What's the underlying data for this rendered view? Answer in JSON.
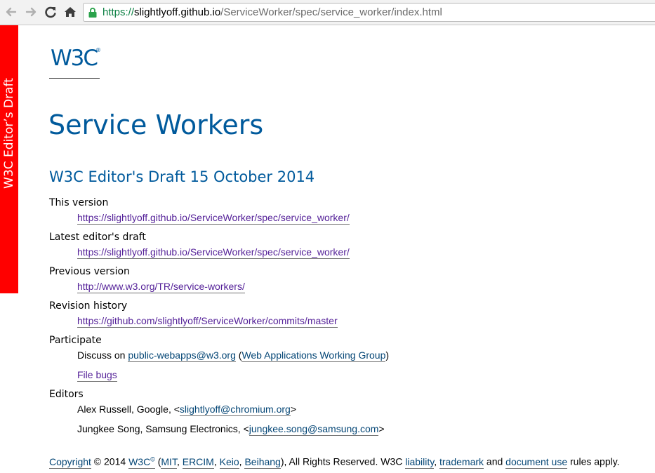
{
  "browser": {
    "back_icon": "back-arrow-icon",
    "forward_icon": "forward-arrow-icon",
    "reload_icon": "reload-icon",
    "home_icon": "home-icon",
    "url": {
      "scheme": "https://",
      "host": "slightlyoff.github.io",
      "path": "/ServiceWorker/spec/service_worker/index.html"
    },
    "secure_color": "#0b8043"
  },
  "badge": {
    "text": "W3C Editor’s Draft",
    "color": "#ff0000"
  },
  "logo": {
    "text": "W3C",
    "reg": "®",
    "color": "#005a9c"
  },
  "doc": {
    "title": "Service Workers",
    "subtitle": "W3C Editor's Draft 15 October 2014",
    "this_version": {
      "label": "This version",
      "link": "https://slightlyoff.github.io/ServiceWorker/spec/service_worker/"
    },
    "latest_draft": {
      "label": "Latest editor's draft",
      "link": "https://slightlyoff.github.io/ServiceWorker/spec/service_worker/"
    },
    "previous_version": {
      "label": "Previous version",
      "link": "http://www.w3.org/TR/service-workers/"
    },
    "revision_history": {
      "label": "Revision history",
      "link": "https://github.com/slightlyoff/ServiceWorker/commits/master"
    },
    "participate": {
      "label": "Participate",
      "discuss_prefix": "Discuss on ",
      "mailing_list": "public-webapps@w3.org",
      "paren_open": " (",
      "working_group": "Web Applications Working Group",
      "paren_close": ")",
      "file_bugs": "File bugs"
    },
    "editors": {
      "label": "Editors",
      "list": [
        {
          "prefix": "Alex Russell, Google, <",
          "email": "slightlyoff@chromium.org",
          "suffix": ">"
        },
        {
          "prefix": "Jungkee Song, Samsung Electronics, <",
          "email": "jungkee.song@samsung.com",
          "suffix": ">"
        }
      ]
    },
    "footer": {
      "copyright": "Copyright",
      "year": " © 2014 ",
      "w3c": "W3C",
      "w3c_sup": "©",
      "paren_open": " (",
      "mit": "MIT",
      "comma1": ", ",
      "ercim": "ERCIM",
      "comma2": ", ",
      "keio": "Keio",
      "comma3": ", ",
      "beihang": "Beihang",
      "rights": "), All Rights Reserved. W3C ",
      "liability": "liability",
      "comma4": ", ",
      "trademark": "trademark",
      "and": " and ",
      "document_use": "document use",
      "apply": " rules apply."
    },
    "link_color": "#034575",
    "visited_color": "#552299"
  }
}
